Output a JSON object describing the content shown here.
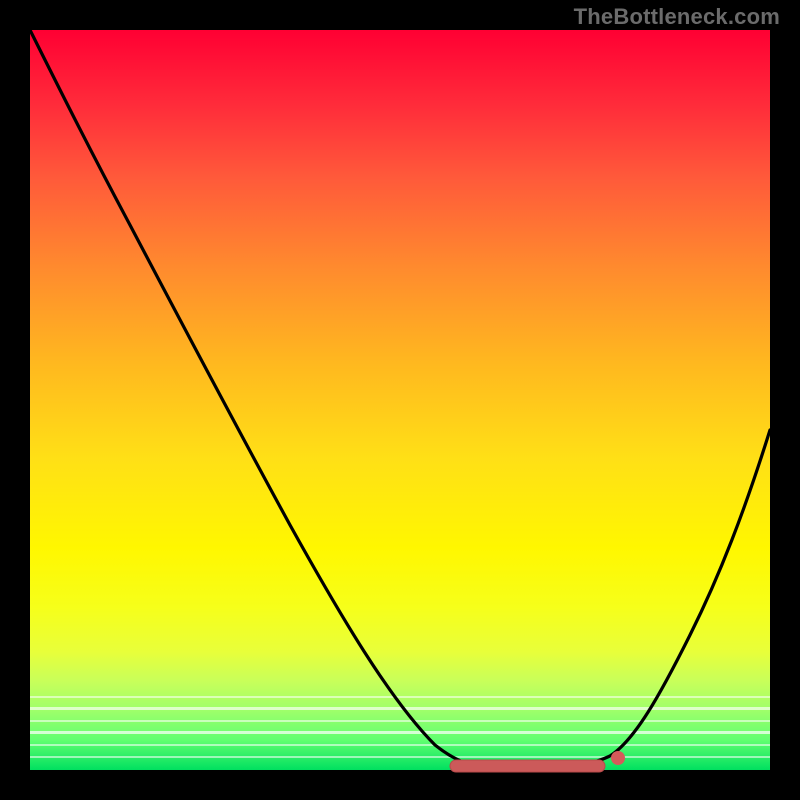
{
  "watermark": "TheBottleneck.com",
  "chart_data": {
    "type": "line",
    "title": "",
    "xlabel": "",
    "ylabel": "",
    "xlim": [
      0,
      100
    ],
    "ylim": [
      0,
      100
    ],
    "x": [
      0,
      6,
      12,
      18,
      24,
      30,
      36,
      42,
      48,
      54,
      58,
      62,
      66,
      70,
      74,
      78,
      80,
      84,
      88,
      92,
      96,
      100
    ],
    "values": [
      100,
      92,
      83,
      74,
      65,
      56,
      47,
      38,
      29,
      18,
      10,
      3,
      1,
      0,
      0,
      1,
      2,
      6,
      13,
      23,
      34,
      46
    ],
    "optimal_range_x": [
      60,
      80
    ],
    "background_gradient": {
      "top": "#ff0033",
      "mid": "#fff700",
      "bottom": "#00e060"
    },
    "curve_color": "#000000",
    "marker_color": "#cc5a5a"
  }
}
